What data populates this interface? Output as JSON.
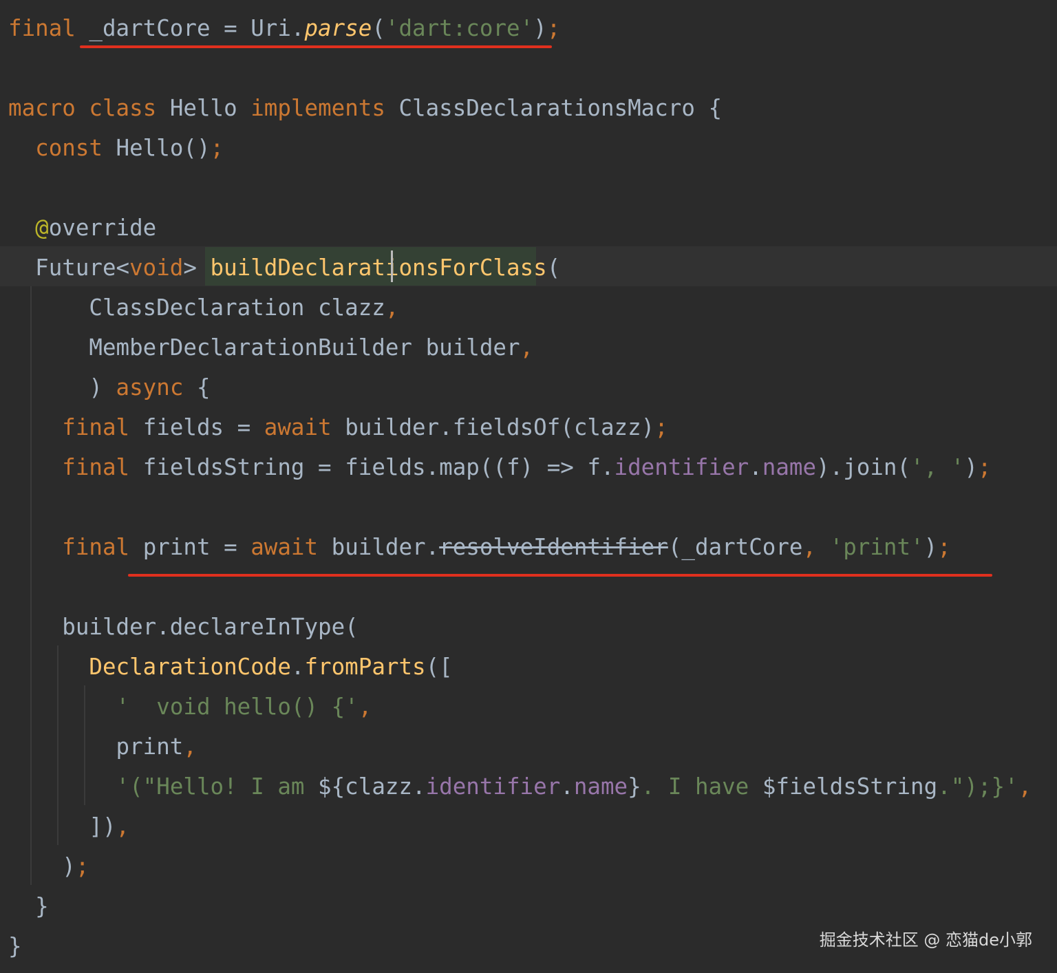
{
  "code_lines": [
    [
      {
        "text": "final",
        "cls": "kw"
      },
      {
        "text": " _dartCore = Uri.",
        "cls": ""
      },
      {
        "text": "parse",
        "cls": "fn it"
      },
      {
        "text": "(",
        "cls": ""
      },
      {
        "text": "'dart:core'",
        "cls": "str"
      },
      {
        "text": ")",
        "cls": ""
      },
      {
        "text": ";",
        "cls": "kw"
      }
    ],
    [],
    [
      {
        "text": "macro",
        "cls": "kw"
      },
      {
        "text": " ",
        "cls": ""
      },
      {
        "text": "class",
        "cls": "kw"
      },
      {
        "text": " Hello ",
        "cls": ""
      },
      {
        "text": "implements",
        "cls": "kw"
      },
      {
        "text": " ClassDeclarationsMacro {",
        "cls": ""
      }
    ],
    [
      {
        "text": "  ",
        "cls": ""
      },
      {
        "text": "const",
        "cls": "kw"
      },
      {
        "text": " Hello()",
        "cls": ""
      },
      {
        "text": ";",
        "cls": "kw"
      }
    ],
    [],
    [
      {
        "text": "  ",
        "cls": ""
      },
      {
        "text": "@",
        "cls": "ann"
      },
      {
        "text": "override",
        "cls": ""
      }
    ],
    [
      {
        "text": "  Future<",
        "cls": ""
      },
      {
        "text": "void",
        "cls": "kw"
      },
      {
        "text": "> ",
        "cls": ""
      },
      {
        "text": "buildDeclarationsForClass",
        "cls": "fn"
      },
      {
        "text": "(",
        "cls": ""
      }
    ],
    [
      {
        "text": "      ClassDeclaration clazz",
        "cls": ""
      },
      {
        "text": ",",
        "cls": "kw"
      }
    ],
    [
      {
        "text": "      MemberDeclarationBuilder builder",
        "cls": ""
      },
      {
        "text": ",",
        "cls": "kw"
      }
    ],
    [
      {
        "text": "      ) ",
        "cls": ""
      },
      {
        "text": "async",
        "cls": "kw"
      },
      {
        "text": " {",
        "cls": ""
      }
    ],
    [
      {
        "text": "    ",
        "cls": ""
      },
      {
        "text": "final",
        "cls": "kw"
      },
      {
        "text": " fields = ",
        "cls": ""
      },
      {
        "text": "await",
        "cls": "kw"
      },
      {
        "text": " builder.fieldsOf(clazz)",
        "cls": ""
      },
      {
        "text": ";",
        "cls": "kw"
      }
    ],
    [
      {
        "text": "    ",
        "cls": ""
      },
      {
        "text": "final",
        "cls": "kw"
      },
      {
        "text": " fieldsString = fields.map((f) => f.",
        "cls": ""
      },
      {
        "text": "identifier",
        "cls": "fld"
      },
      {
        "text": ".",
        "cls": ""
      },
      {
        "text": "name",
        "cls": "fld"
      },
      {
        "text": ").join(",
        "cls": ""
      },
      {
        "text": "', '",
        "cls": "str"
      },
      {
        "text": ")",
        "cls": ""
      },
      {
        "text": ";",
        "cls": "kw"
      }
    ],
    [],
    [
      {
        "text": "    ",
        "cls": ""
      },
      {
        "text": "final",
        "cls": "kw"
      },
      {
        "text": " print = ",
        "cls": ""
      },
      {
        "text": "await",
        "cls": "kw"
      },
      {
        "text": " builder.",
        "cls": ""
      },
      {
        "text": "resolveIdentifier",
        "cls": "strike"
      },
      {
        "text": "(_dartCore",
        "cls": ""
      },
      {
        "text": ", ",
        "cls": "kw"
      },
      {
        "text": "'print'",
        "cls": "str"
      },
      {
        "text": ")",
        "cls": ""
      },
      {
        "text": ";",
        "cls": "kw"
      }
    ],
    [],
    [
      {
        "text": "    builder.declareInType(",
        "cls": ""
      }
    ],
    [
      {
        "text": "      ",
        "cls": ""
      },
      {
        "text": "DeclarationCode",
        "cls": "fn"
      },
      {
        "text": ".",
        "cls": ""
      },
      {
        "text": "fromParts",
        "cls": "fn"
      },
      {
        "text": "([",
        "cls": ""
      }
    ],
    [
      {
        "text": "        ",
        "cls": ""
      },
      {
        "text": "'  void hello() {'",
        "cls": "str"
      },
      {
        "text": ",",
        "cls": "kw"
      }
    ],
    [
      {
        "text": "        print",
        "cls": ""
      },
      {
        "text": ",",
        "cls": "kw"
      }
    ],
    [
      {
        "text": "        ",
        "cls": ""
      },
      {
        "text": "'(\"Hello! I am ",
        "cls": "str"
      },
      {
        "text": "${clazz.",
        "cls": ""
      },
      {
        "text": "identifier",
        "cls": "fld"
      },
      {
        "text": ".",
        "cls": ""
      },
      {
        "text": "name",
        "cls": "fld"
      },
      {
        "text": "}",
        "cls": ""
      },
      {
        "text": ". I have ",
        "cls": "str"
      },
      {
        "text": "$fieldsString",
        "cls": ""
      },
      {
        "text": ".\");}'",
        "cls": "str"
      },
      {
        "text": ",",
        "cls": "kw"
      }
    ],
    [
      {
        "text": "      ])",
        "cls": ""
      },
      {
        "text": ",",
        "cls": "kw"
      }
    ],
    [
      {
        "text": "    )",
        "cls": ""
      },
      {
        "text": ";",
        "cls": "kw"
      }
    ],
    [
      {
        "text": "  }",
        "cls": ""
      }
    ],
    [
      {
        "text": "}",
        "cls": ""
      }
    ]
  ],
  "watermark": "掘金技术社区 @ 恋猫de小郭",
  "colors": {
    "background": "#2b2b2b",
    "keyword": "#cc7832",
    "string": "#6a8759",
    "function": "#ffc66d",
    "field": "#9876aa",
    "annotation": "#bbb529",
    "text": "#a9b7c6",
    "red_underline": "#e0301e"
  }
}
